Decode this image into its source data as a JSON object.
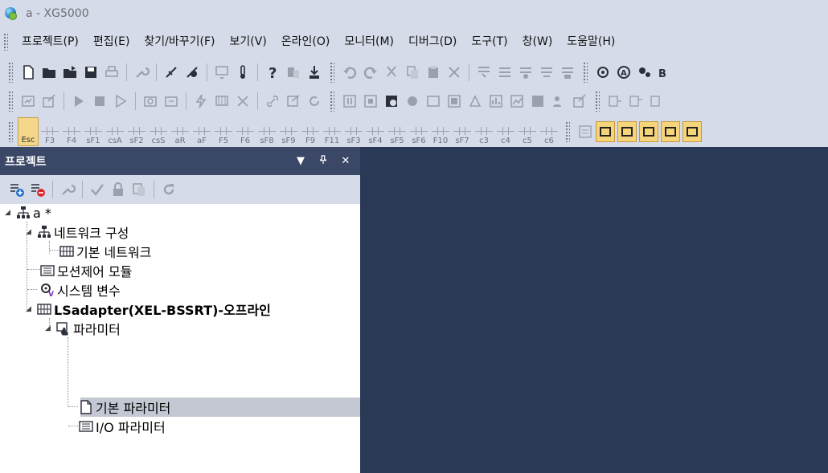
{
  "window": {
    "title": "a - XG5000"
  },
  "menu": [
    "프로젝트(P)",
    "편집(E)",
    "찾기/바꾸기(F)",
    "보기(V)",
    "온라인(O)",
    "모니터(M)",
    "디버그(D)",
    "도구(T)",
    "창(W)",
    "도움말(H)"
  ],
  "ladder_toolbar": {
    "keys": [
      "Esc",
      "F3",
      "F4",
      "sF1",
      "csA",
      "sF2",
      "csS",
      "aR",
      "aF",
      "F5",
      "F6",
      "sF8",
      "sF9",
      "F9",
      "F11",
      "sF3",
      "sF4",
      "sF5",
      "sF6",
      "F10",
      "sF7",
      "c3",
      "c4",
      "c5",
      "c6"
    ]
  },
  "project_panel": {
    "title": "프로젝트",
    "pin": "ᴾ",
    "close": "✕",
    "dropdown": "▼"
  },
  "tree": {
    "root": "a *",
    "network_config": "네트워크 구성",
    "basic_network": "기본 네트워크",
    "motion_module": "모션제어 모듈",
    "system_variables": "시스템 변수",
    "adapter": "LSadapter(XEL-BSSRT)-오프라인",
    "parameters": "파라미터",
    "basic_parameters": "기본 파라미터",
    "io_parameters": "I/O 파라미터"
  },
  "colors": {
    "panel_header": "#3b4766",
    "editor_bg": "#293956",
    "chrome": "#d6dbe9",
    "selection": "#c4c8d3"
  }
}
